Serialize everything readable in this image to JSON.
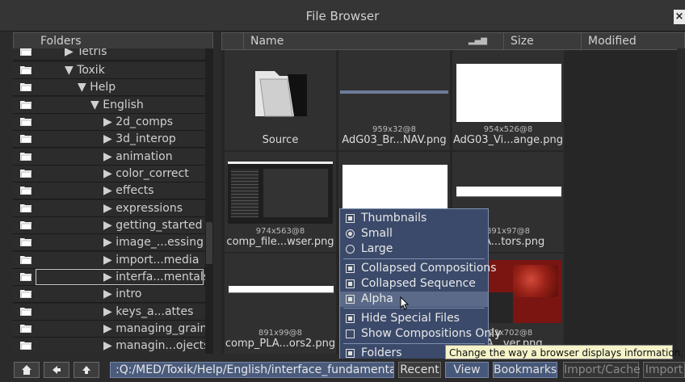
{
  "window": {
    "title": "File Browser",
    "close_label": "×"
  },
  "folders": {
    "header": "Folders",
    "items": [
      {
        "label": "Tetris"
      },
      {
        "label": "Toxik"
      },
      {
        "label": "Help"
      },
      {
        "label": "English"
      },
      {
        "label": "2d_comps"
      },
      {
        "label": "3d_interop"
      },
      {
        "label": "animation"
      },
      {
        "label": "color_correct"
      },
      {
        "label": "effects"
      },
      {
        "label": "expressions"
      },
      {
        "label": "getting_started"
      },
      {
        "label": "image_...essing"
      },
      {
        "label": "import...media"
      },
      {
        "label": "interfa...mentals"
      },
      {
        "label": "intro"
      },
      {
        "label": "keys_a...attes"
      },
      {
        "label": "managing_grain"
      },
      {
        "label": "managin...ojects"
      }
    ]
  },
  "files": {
    "columns": {
      "name": "Name",
      "size": "Size",
      "modified": "Modified"
    },
    "items": [
      {
        "res": "",
        "name": "Source"
      },
      {
        "res": "959x32@8",
        "name": "AdG03_Br...NAV.png"
      },
      {
        "res": "954x526@8",
        "name": "AdG03_Vi...ange.png"
      },
      {
        "res": "974x563@8",
        "name": "comp_file...wser.png"
      },
      {
        "res": "",
        "name": ""
      },
      {
        "res": "891x97@8",
        "name": "PLA...tors.png"
      },
      {
        "res": "891x99@8",
        "name": "comp_PLA...ors2.png"
      },
      {
        "res": "",
        "name": ""
      },
      {
        "res": "123x702@8",
        "name": "PLA...ver.png"
      }
    ]
  },
  "menu": {
    "items": [
      {
        "label": "Thumbnails",
        "kind": "checkbox",
        "checked": true
      },
      {
        "label": "Small",
        "kind": "radio",
        "checked": true
      },
      {
        "label": "Large",
        "kind": "radio",
        "checked": false
      },
      {
        "label": "Collapsed Compositions",
        "kind": "checkbox",
        "checked": true
      },
      {
        "label": "Collapsed Sequence",
        "kind": "checkbox",
        "checked": true
      },
      {
        "label": "Alpha",
        "kind": "checkbox",
        "checked": true
      },
      {
        "label": "Hide Special Files",
        "kind": "checkbox",
        "checked": true
      },
      {
        "label": "Show Compositions Only",
        "kind": "checkbox",
        "checked": false
      },
      {
        "label": "Folders",
        "kind": "checkbox",
        "checked": true
      }
    ]
  },
  "tooltip": "Change the way a browser displays information.",
  "bottom": {
    "home_icon": "home-icon",
    "back_icon": "left-arrow-icon",
    "up_icon": "up-arrow-icon",
    "path": ":Q:/MED/Toxik/Help/English/interface_fundamentals",
    "recent": "Recent",
    "view": "View",
    "bookmarks": "Bookmarks",
    "import_cache": "Import/Cache",
    "import": "Import"
  },
  "colors": {
    "accent": "#47597a",
    "menu_bg": "#3b4a6a",
    "tooltip_bg": "#f5f3c8"
  }
}
